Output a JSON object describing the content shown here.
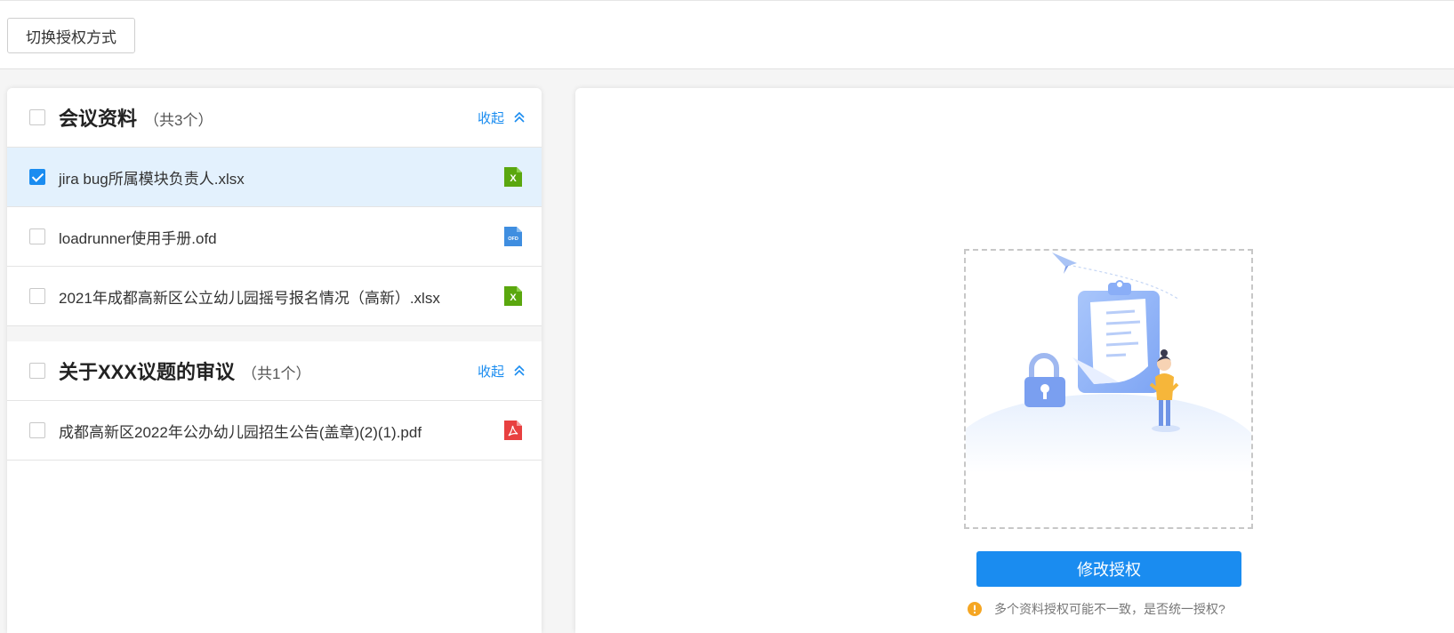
{
  "toolbar": {
    "switch_label": "切换授权方式"
  },
  "groups": [
    {
      "title": "会议资料",
      "count": "（共3个）",
      "collapse_label": "收起",
      "files": [
        {
          "name": "jira bug所属模块负责人.xlsx",
          "type": "xlsx",
          "checked": true
        },
        {
          "name": "loadrunner使用手册.ofd",
          "type": "ofd",
          "checked": false
        },
        {
          "name": "2021年成都高新区公立幼儿园摇号报名情况（高新）.xlsx",
          "type": "xlsx",
          "checked": false
        }
      ]
    },
    {
      "title": "关于XXX议题的审议",
      "count": "（共1个）",
      "collapse_label": "收起",
      "files": [
        {
          "name": "成都高新区2022年公办幼儿园招生公告(盖章)(2)(1).pdf",
          "type": "pdf",
          "checked": false
        }
      ]
    }
  ],
  "file_icon_labels": {
    "xlsx": "X",
    "ofd": "OFD"
  },
  "main": {
    "modify_label": "修改授权",
    "hint_text": "多个资料授权可能不一致，是否统一授权?"
  },
  "colors": {
    "accent": "#1a8cf0",
    "selected_row": "#e3f1fd",
    "xlsx_icon": "#5aa70e",
    "ofd_icon": "#3f8ee0",
    "pdf_icon": "#e84040",
    "warning": "#f5a623"
  }
}
